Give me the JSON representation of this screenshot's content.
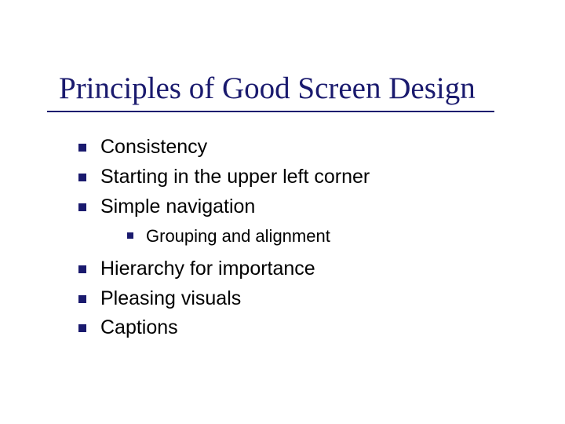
{
  "title": "Principles of Good Screen Design",
  "bullets": [
    {
      "text": "Consistency"
    },
    {
      "text": "Starting in the upper left corner"
    },
    {
      "text": "Simple navigation",
      "sub": [
        {
          "text": "Grouping and alignment"
        }
      ]
    },
    {
      "text": "Hierarchy for importance"
    },
    {
      "text": "Pleasing visuals"
    },
    {
      "text": "Captions"
    }
  ]
}
